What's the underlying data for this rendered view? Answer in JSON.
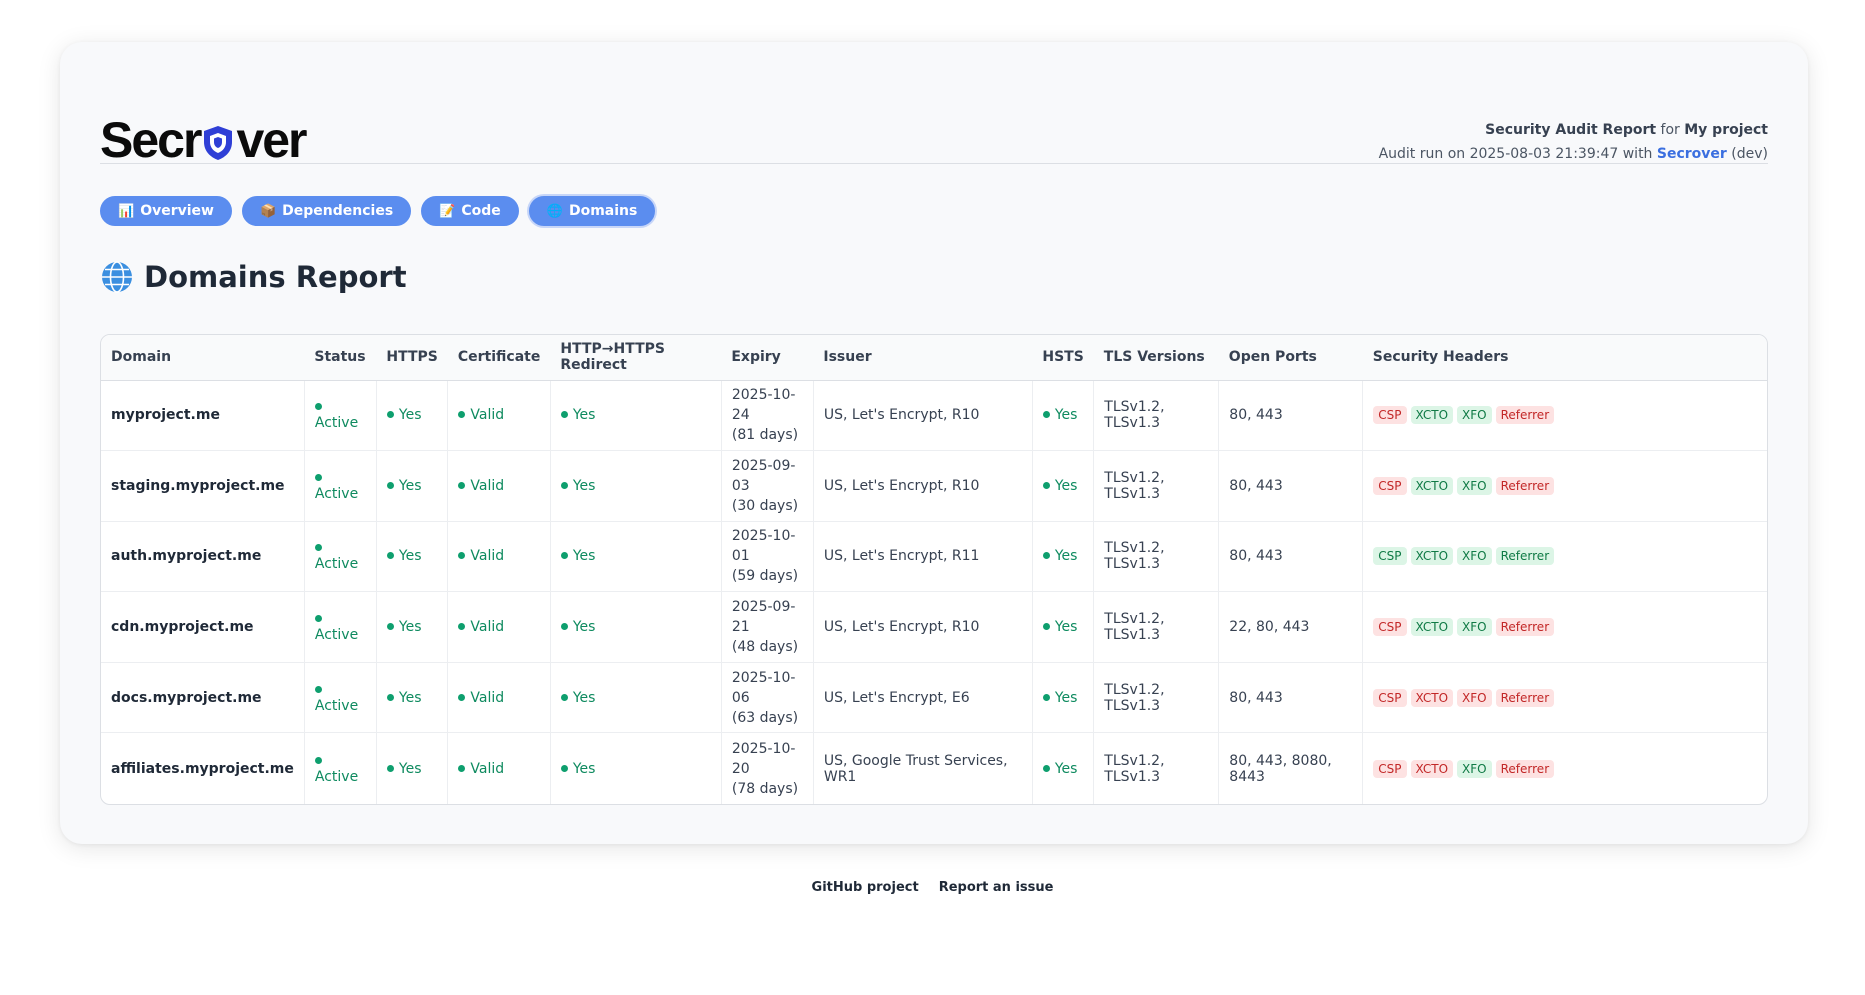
{
  "brand": {
    "name_before": "Secr",
    "name_after": "ver"
  },
  "meta": {
    "line1_title": "Security Audit Report",
    "line1_for": "for",
    "line1_project": "My project",
    "line2_prefix": "Audit run on 2025-08-03 21:39:47 with",
    "line2_link": "Secrover",
    "line2_suffix": "(dev)"
  },
  "nav": [
    {
      "icon": "📊",
      "label": "Overview"
    },
    {
      "icon": "📦",
      "label": "Dependencies"
    },
    {
      "icon": "📝",
      "label": "Code"
    },
    {
      "icon": "🌐",
      "label": "Domains"
    }
  ],
  "page_title": "Domains Report",
  "colors": {
    "accent": "#5b8def",
    "ok": "#0e9f6e",
    "bad_bg": "#fde2e2",
    "good_bg": "#dcf5e6"
  },
  "table": {
    "headers": [
      "Domain",
      "Status",
      "HTTPS",
      "Certificate",
      "HTTP→HTTPS Redirect",
      "Expiry",
      "Issuer",
      "HSTS",
      "TLS Versions",
      "Open Ports",
      "Security Headers"
    ],
    "rows": [
      {
        "domain": "myproject.me",
        "status": "Active",
        "https": "Yes",
        "cert": "Valid",
        "redirect": "Yes",
        "expiry_date": "2025-10-24",
        "expiry_days": "(81 days)",
        "issuer": "US, Let's Encrypt, R10",
        "hsts": "Yes",
        "tls": "TLSv1.2, TLSv1.3",
        "ports": "80, 443",
        "headers": [
          {
            "label": "CSP",
            "ok": false
          },
          {
            "label": "XCTO",
            "ok": true
          },
          {
            "label": "XFO",
            "ok": true
          },
          {
            "label": "Referrer",
            "ok": false
          }
        ]
      },
      {
        "domain": "staging.myproject.me",
        "status": "Active",
        "https": "Yes",
        "cert": "Valid",
        "redirect": "Yes",
        "expiry_date": "2025-09-03",
        "expiry_days": "(30 days)",
        "issuer": "US, Let's Encrypt, R10",
        "hsts": "Yes",
        "tls": "TLSv1.2, TLSv1.3",
        "ports": "80, 443",
        "headers": [
          {
            "label": "CSP",
            "ok": false
          },
          {
            "label": "XCTO",
            "ok": true
          },
          {
            "label": "XFO",
            "ok": true
          },
          {
            "label": "Referrer",
            "ok": false
          }
        ]
      },
      {
        "domain": "auth.myproject.me",
        "status": "Active",
        "https": "Yes",
        "cert": "Valid",
        "redirect": "Yes",
        "expiry_date": "2025-10-01",
        "expiry_days": "(59 days)",
        "issuer": "US, Let's Encrypt, R11",
        "hsts": "Yes",
        "tls": "TLSv1.2, TLSv1.3",
        "ports": "80, 443",
        "headers": [
          {
            "label": "CSP",
            "ok": true
          },
          {
            "label": "XCTO",
            "ok": true
          },
          {
            "label": "XFO",
            "ok": true
          },
          {
            "label": "Referrer",
            "ok": true
          }
        ]
      },
      {
        "domain": "cdn.myproject.me",
        "status": "Active",
        "https": "Yes",
        "cert": "Valid",
        "redirect": "Yes",
        "expiry_date": "2025-09-21",
        "expiry_days": "(48 days)",
        "issuer": "US, Let's Encrypt, R10",
        "hsts": "Yes",
        "tls": "TLSv1.2, TLSv1.3",
        "ports": "22, 80, 443",
        "headers": [
          {
            "label": "CSP",
            "ok": false
          },
          {
            "label": "XCTO",
            "ok": true
          },
          {
            "label": "XFO",
            "ok": true
          },
          {
            "label": "Referrer",
            "ok": false
          }
        ]
      },
      {
        "domain": "docs.myproject.me",
        "status": "Active",
        "https": "Yes",
        "cert": "Valid",
        "redirect": "Yes",
        "expiry_date": "2025-10-06",
        "expiry_days": "(63 days)",
        "issuer": "US, Let's Encrypt, E6",
        "hsts": "Yes",
        "tls": "TLSv1.2, TLSv1.3",
        "ports": "80, 443",
        "headers": [
          {
            "label": "CSP",
            "ok": false
          },
          {
            "label": "XCTO",
            "ok": false
          },
          {
            "label": "XFO",
            "ok": false
          },
          {
            "label": "Referrer",
            "ok": false
          }
        ]
      },
      {
        "domain": "affiliates.myproject.me",
        "status": "Active",
        "https": "Yes",
        "cert": "Valid",
        "redirect": "Yes",
        "expiry_date": "2025-10-20",
        "expiry_days": "(78 days)",
        "issuer": "US, Google Trust Services, WR1",
        "hsts": "Yes",
        "tls": "TLSv1.2, TLSv1.3",
        "ports": "80, 443, 8080, 8443",
        "headers": [
          {
            "label": "CSP",
            "ok": false
          },
          {
            "label": "XCTO",
            "ok": false
          },
          {
            "label": "XFO",
            "ok": true
          },
          {
            "label": "Referrer",
            "ok": false
          }
        ]
      }
    ]
  },
  "footer": {
    "github": "GitHub project",
    "issue": "Report an issue"
  }
}
